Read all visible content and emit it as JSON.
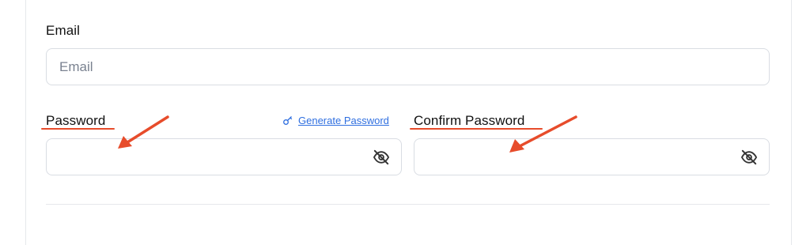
{
  "form": {
    "email": {
      "label": "Email",
      "placeholder": "Email",
      "value": ""
    },
    "password": {
      "label": "Password",
      "value": ""
    },
    "generate_password": {
      "label": "Generate Password",
      "icon": "key-icon"
    },
    "confirm_password": {
      "label": "Confirm Password",
      "value": ""
    },
    "toggle_icon": "eye-off-icon"
  },
  "annotations": {
    "color": "#e74c2b"
  },
  "colors": {
    "link": "#2f6fe0",
    "border": "#d9dde3"
  }
}
